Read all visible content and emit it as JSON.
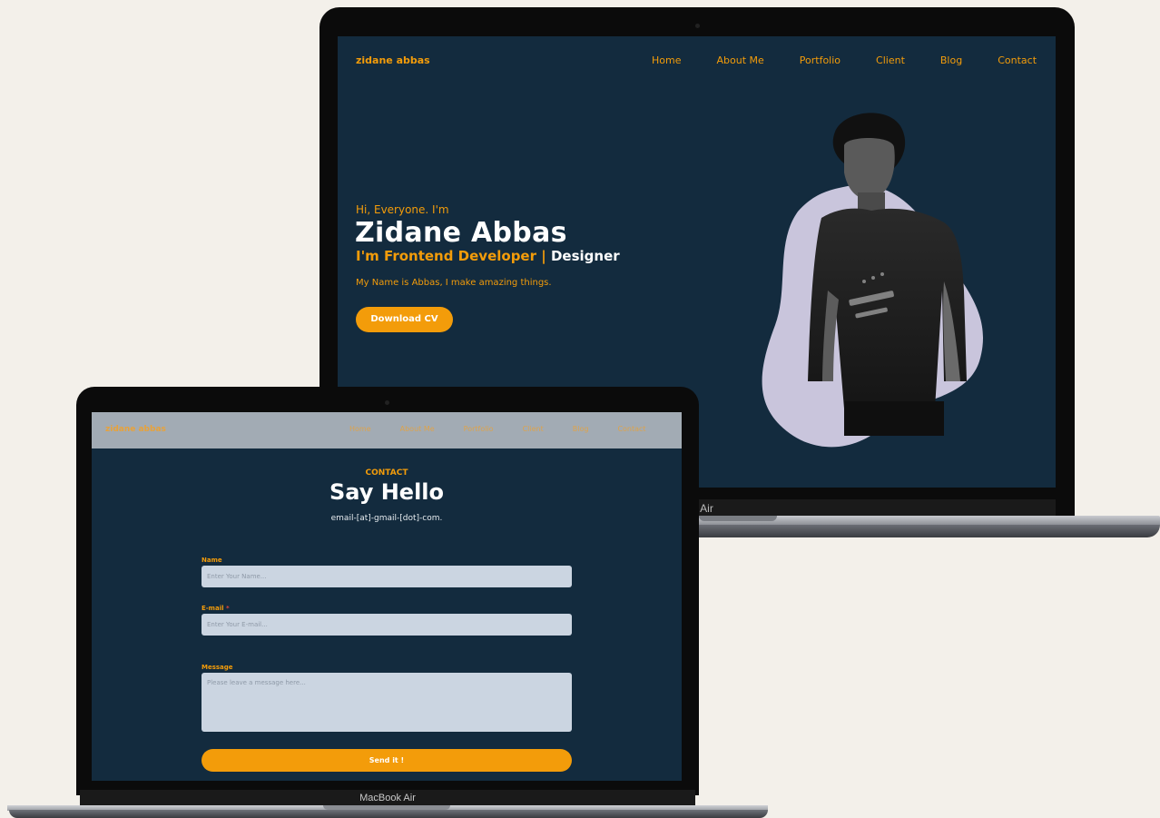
{
  "hero_site": {
    "logo": "zidane abbas",
    "nav": [
      "Home",
      "About Me",
      "Portfolio",
      "Client",
      "Blog",
      "Contact"
    ],
    "greeting": "Hi, Everyone. I'm",
    "name": "Zidane Abbas",
    "role_prefix": "I'm Frontend Developer |",
    "role_highlight": "Designer",
    "description": "My Name is Abbas, I make amazing things.",
    "cta": "Download CV",
    "device_label": "ook Air"
  },
  "contact_site": {
    "logo": "zidane abbas",
    "nav": [
      "Home",
      "About Me",
      "Portfolio",
      "Client",
      "Blog",
      "Contact"
    ],
    "kicker": "CONTACT",
    "title": "Say Hello",
    "email": "email-[at]-gmail-[dot]-com.",
    "form": {
      "name_label": "Name",
      "name_placeholder": "Enter Your Name...",
      "email_label": "E-mail",
      "email_required": "*",
      "email_placeholder": "Enter Your E-mail...",
      "message_label": "Message",
      "message_placeholder": "Please leave a message here...",
      "submit": "Send it !"
    },
    "device_label": "MacBook Air"
  },
  "colors": {
    "page_bg": "#f3f0ea",
    "screen_bg": "#132b3e",
    "accent": "#f39c0a",
    "blob": "#c9c5dc",
    "input_bg": "#cbd5e1",
    "nav_bar": "#a2abb4"
  }
}
